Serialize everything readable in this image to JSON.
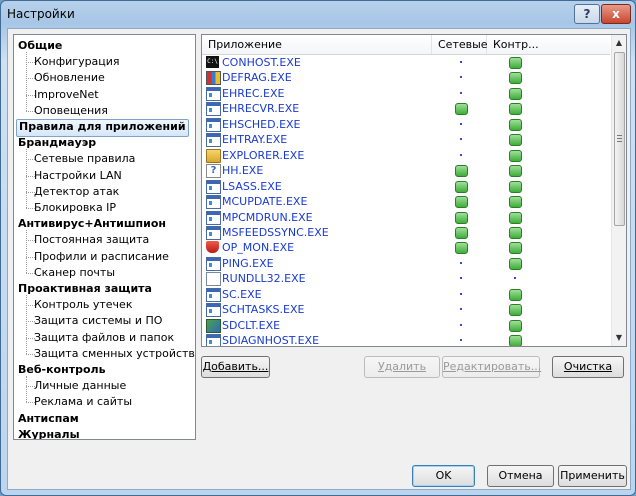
{
  "window": {
    "title": "Настройки"
  },
  "titlebar": {
    "help_glyph": "?",
    "close_glyph": "x"
  },
  "tree": {
    "categories": [
      {
        "label": "Общие",
        "items": [
          "Конфигурация",
          "Обновление",
          "ImproveNet",
          "Оповещения"
        ]
      },
      {
        "label": "Правила для приложений",
        "items": []
      },
      {
        "label": "Брандмауэр",
        "items": [
          "Сетевые правила",
          "Настройки LAN",
          "Детектор атак",
          "Блокировка IP"
        ]
      },
      {
        "label": "Антивирус+Антишпион",
        "items": [
          "Постоянная защита",
          "Профили и расписание",
          "Сканер почты"
        ]
      },
      {
        "label": "Проактивная защита",
        "items": [
          "Контроль утечек",
          "Защита системы и ПО",
          "Защита файлов и папок",
          "Защита сменных устройств"
        ]
      },
      {
        "label": "Веб-контроль",
        "items": [
          "Личные данные",
          "Реклама и сайты"
        ]
      },
      {
        "label": "Антиспам",
        "items": []
      },
      {
        "label": "Журналы",
        "items": []
      }
    ],
    "selected": "Правила для приложений"
  },
  "list": {
    "columns": [
      "Приложение",
      "Сетевые",
      "Контр..."
    ],
    "rows": [
      {
        "name": "CONHOST.EXE",
        "icon": "console-icon",
        "network": "dot",
        "control": "green"
      },
      {
        "name": "DEFRAG.EXE",
        "icon": "defrag-icon",
        "network": "dot",
        "control": "green"
      },
      {
        "name": "EHREC.EXE",
        "icon": "exe-icon",
        "network": "dot",
        "control": "green"
      },
      {
        "name": "EHRECVR.EXE",
        "icon": "exe-icon",
        "network": "green",
        "control": "green"
      },
      {
        "name": "EHSCHED.EXE",
        "icon": "exe-icon",
        "network": "dot",
        "control": "green"
      },
      {
        "name": "EHTRAY.EXE",
        "icon": "exe-icon",
        "network": "dot",
        "control": "green"
      },
      {
        "name": "EXPLORER.EXE",
        "icon": "explorer-icon",
        "network": "dot",
        "control": "green"
      },
      {
        "name": "HH.EXE",
        "icon": "help-icon",
        "network": "green",
        "control": "green"
      },
      {
        "name": "LSASS.EXE",
        "icon": "exe-icon",
        "network": "green",
        "control": "green"
      },
      {
        "name": "MCUPDATE.EXE",
        "icon": "exe-icon",
        "network": "green",
        "control": "green"
      },
      {
        "name": "MPCMDRUN.EXE",
        "icon": "exe-icon",
        "network": "green",
        "control": "green"
      },
      {
        "name": "MSFEEDSSYNC.EXE",
        "icon": "exe-icon",
        "network": "green",
        "control": "green"
      },
      {
        "name": "OP_MON.EXE",
        "icon": "shield-icon",
        "network": "green",
        "control": "green"
      },
      {
        "name": "PING.EXE",
        "icon": "exe-icon",
        "network": "dot",
        "control": "green"
      },
      {
        "name": "RUNDLL32.EXE",
        "icon": "document-icon",
        "network": "dot",
        "control": "dot"
      },
      {
        "name": "SC.EXE",
        "icon": "exe-icon",
        "network": "dot",
        "control": "green"
      },
      {
        "name": "SCHTASKS.EXE",
        "icon": "exe-icon",
        "network": "dot",
        "control": "green"
      },
      {
        "name": "SDCLT.EXE",
        "icon": "backup-icon",
        "network": "dot",
        "control": "green"
      },
      {
        "name": "SDIAGNHOST.EXE",
        "icon": "exe-icon",
        "network": "dot",
        "control": "green"
      }
    ]
  },
  "scrollbar": {
    "up_glyph": "▲",
    "down_glyph": "▼"
  },
  "list_buttons": {
    "add": "Добавить...",
    "delete": "Удалить",
    "edit": "Редактировать...",
    "clear": "Очистка"
  },
  "dialog_buttons": {
    "ok": "OK",
    "cancel": "Отмена",
    "apply": "Применить"
  }
}
